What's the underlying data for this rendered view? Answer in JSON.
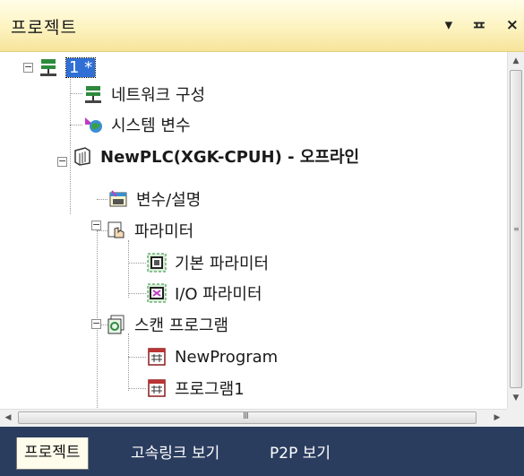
{
  "panel": {
    "title": "프로젝트",
    "controls": [
      "▾",
      "ᄑ",
      "×"
    ]
  },
  "tree": {
    "nodes": [
      {
        "label": "1 *",
        "icon": "project-network-icon"
      },
      {
        "label": "네트워크 구성",
        "icon": "network-config-icon"
      },
      {
        "label": "시스템 변수",
        "icon": "system-variable-icon"
      },
      {
        "label": "NewPLC(XGK-CPUH) - 오프라인",
        "icon": "plc-icon"
      },
      {
        "label": "변수/설명",
        "icon": "variable-comment-icon"
      },
      {
        "label": "파라미터",
        "icon": "parameter-icon"
      },
      {
        "label": "기본 파라미터",
        "icon": "basic-parameter-icon"
      },
      {
        "label": "I/O 파라미터",
        "icon": "io-parameter-icon"
      },
      {
        "label": "스캔 프로그램",
        "icon": "scan-program-icon"
      },
      {
        "label": "NewProgram",
        "icon": "program-icon"
      },
      {
        "label": "프로그램1",
        "icon": "program-icon"
      }
    ]
  },
  "scrollbar": {
    "h_grip": "III"
  },
  "tabs": [
    "프로젝트",
    "고속링크 보기",
    "P2P 보기"
  ]
}
